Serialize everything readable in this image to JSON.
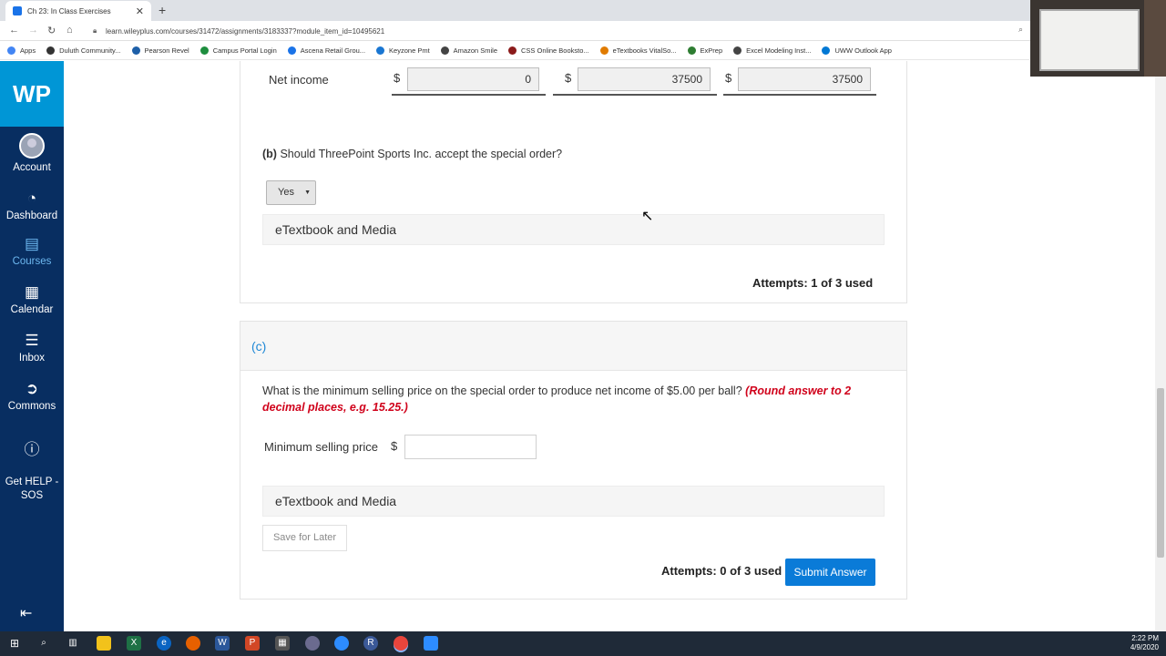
{
  "browser": {
    "tab_title": "Ch 23: In Class Exercises",
    "url": "learn.wileyplus.com/courses/31472/assignments/3183337?module_item_id=10495621",
    "bookmarks": [
      {
        "label": "Apps",
        "color": "#4285f4"
      },
      {
        "label": "Duluth Community...",
        "color": "#333333"
      },
      {
        "label": "Pearson Revel",
        "color": "#1d5fa8"
      },
      {
        "label": "Campus Portal Login",
        "color": "#1e8e3e"
      },
      {
        "label": "Ascena Retail Grou...",
        "color": "#1a73e8"
      },
      {
        "label": "Keyzone Pmt",
        "color": "#1976d2"
      },
      {
        "label": "Amazon Smile",
        "color": "#444444"
      },
      {
        "label": "CSS Online Booksto...",
        "color": "#8b1a1a"
      },
      {
        "label": "eTextbooks VitalSo...",
        "color": "#e07b00"
      },
      {
        "label": "ExPrep",
        "color": "#2e7d32"
      },
      {
        "label": "Excel Modeling Inst...",
        "color": "#444444"
      },
      {
        "label": "UWW Outlook App",
        "color": "#0078d4"
      }
    ]
  },
  "sidebar": {
    "logo": "WP",
    "items": [
      {
        "label": "Account",
        "icon": "user-avatar-icon"
      },
      {
        "label": "Dashboard",
        "icon": "dashboard-gauge-icon"
      },
      {
        "label": "Courses",
        "icon": "book-icon"
      },
      {
        "label": "Calendar",
        "icon": "calendar-icon"
      },
      {
        "label": "Inbox",
        "icon": "inbox-icon"
      },
      {
        "label": "Commons",
        "icon": "commons-arrow-icon"
      },
      {
        "label": "Get HELP -\nSOS",
        "icon": "help-question-icon"
      }
    ],
    "accent_active": "#6db8f0",
    "background": "#082e61"
  },
  "part_b": {
    "net_income_label": "Net income",
    "net_income_values": [
      "0",
      "37500",
      "37500"
    ],
    "currency": "$",
    "question_prefix": "(b)",
    "question": "Should ThreePoint Sports Inc. accept the special order?",
    "select_value": "Yes",
    "etextbook": "eTextbook and Media",
    "attempts": "Attempts: 1 of 3 used"
  },
  "part_c": {
    "header": "(c)",
    "question": "What is the minimum selling price on the special order to produce net income of $5.00 per ball?",
    "instruction": "(Round answer to 2 decimal places, e.g. 15.25.)",
    "field_label": "Minimum selling price",
    "currency": "$",
    "field_value": "",
    "etextbook": "eTextbook and Media",
    "save_button": "Save for Later",
    "attempts": "Attempts: 0 of 3 used",
    "submit_button": "Submit Answer",
    "submit_color": "#0a7bd8",
    "instruction_color": "#d0021b"
  },
  "taskbar": {
    "time": "2:22 PM",
    "date": "4/9/2020"
  }
}
